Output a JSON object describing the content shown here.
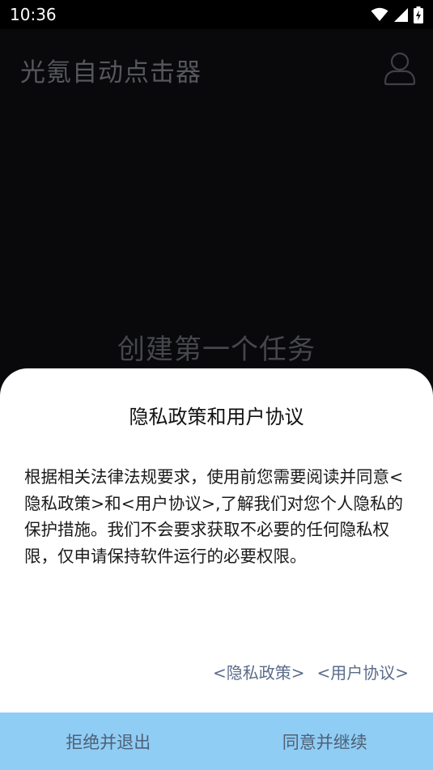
{
  "status_bar": {
    "time": "10:36",
    "icons": [
      "wifi-icon",
      "cellular-signal-icon",
      "battery-charging-icon"
    ]
  },
  "app": {
    "title": "光氪自动点击器",
    "account_icon": "user-account-icon",
    "empty_state_title": "创建第一个任务"
  },
  "dialog": {
    "title": "隐私政策和用户协议",
    "body": "根据相关法律法规要求，使用前您需要阅读并同意<隐私政策>和<用户协议>,了解我们对您个人隐私的保护措施。我们不会要求获取不必要的任何隐私权限，仅申请保持软件运行的必要权限。",
    "privacy_link": "<隐私政策>",
    "agreement_link": "<用户协议>",
    "decline_label": "拒绝并退出",
    "accept_label": "同意并继续"
  },
  "colors": {
    "background": "#09090b",
    "sheet": "#ffffff",
    "button_bar": "#8fcdf5",
    "link": "#5b6c8a"
  }
}
